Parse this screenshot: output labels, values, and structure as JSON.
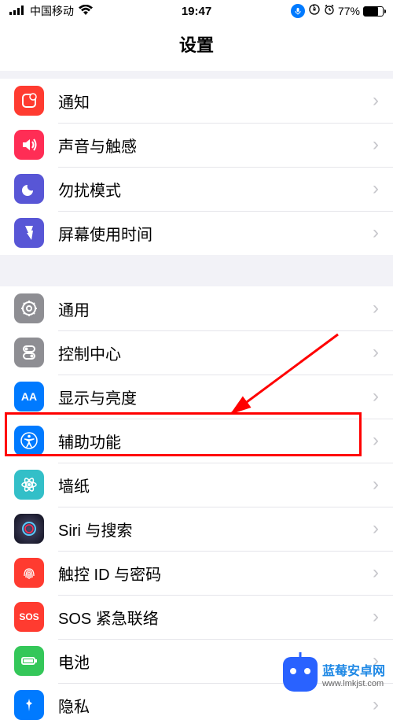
{
  "status": {
    "carrier": "中国移动",
    "time": "19:47",
    "battery_pct": "77%"
  },
  "title": "设置",
  "sections": [
    {
      "rows": [
        {
          "id": "notifications",
          "icon": "notifications-icon",
          "bg": "#ff3b30",
          "label": "通知"
        },
        {
          "id": "sounds",
          "icon": "sounds-icon",
          "bg": "#ff2d55",
          "label": "声音与触感"
        },
        {
          "id": "dnd",
          "icon": "dnd-icon",
          "bg": "#5856d6",
          "label": "勿扰模式"
        },
        {
          "id": "screentime",
          "icon": "screentime-icon",
          "bg": "#5856d6",
          "label": "屏幕使用时间"
        }
      ]
    },
    {
      "rows": [
        {
          "id": "general",
          "icon": "general-icon",
          "bg": "#8e8e93",
          "label": "通用"
        },
        {
          "id": "controlcenter",
          "icon": "controlcenter-icon",
          "bg": "#8e8e93",
          "label": "控制中心"
        },
        {
          "id": "display",
          "icon": "display-icon",
          "bg": "#007aff",
          "label": "显示与亮度"
        },
        {
          "id": "accessibility",
          "icon": "accessibility-icon",
          "bg": "#007aff",
          "label": "辅助功能",
          "highlighted": true
        },
        {
          "id": "wallpaper",
          "icon": "wallpaper-icon",
          "bg": "#33bfc8",
          "label": "墙纸"
        },
        {
          "id": "siri",
          "icon": "siri-icon",
          "bg": "#1c1c1e",
          "label": "Siri 与搜索"
        },
        {
          "id": "touchid",
          "icon": "touchid-icon",
          "bg": "#ff3b30",
          "label": "触控 ID 与密码"
        },
        {
          "id": "sos",
          "icon": "sos-icon",
          "bg": "#ff3b30",
          "label": "SOS 紧急联络"
        },
        {
          "id": "battery",
          "icon": "battery-icon",
          "bg": "#34c759",
          "label": "电池"
        },
        {
          "id": "privacy",
          "icon": "privacy-icon",
          "bg": "#007aff",
          "label": "隐私"
        }
      ]
    }
  ],
  "watermark": {
    "brand": "蓝莓安卓网",
    "url": "www.lmkjst.com"
  }
}
